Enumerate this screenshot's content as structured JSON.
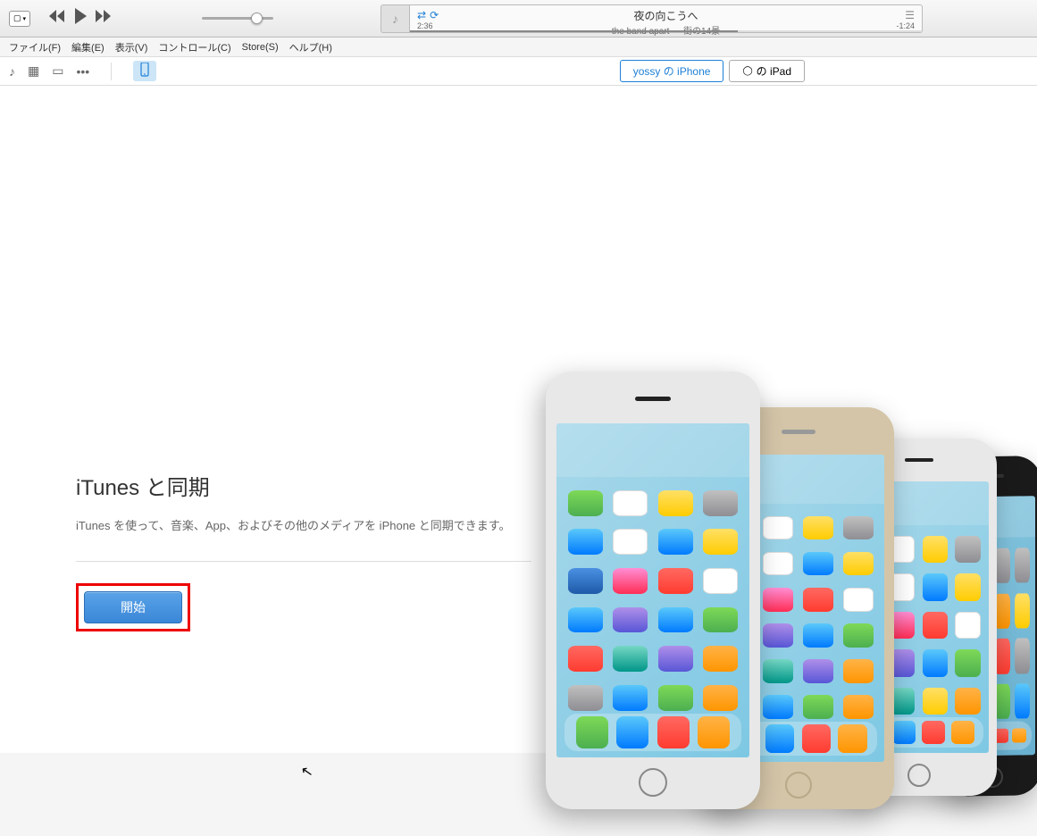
{
  "player": {
    "elapsed": "2:36",
    "remaining": "-1:24",
    "track_title": "夜の向こうへ",
    "track_artist": "the band apart — 街の14景"
  },
  "menu": {
    "file": "ファイル(F)",
    "edit": "編集(E)",
    "view": "表示(V)",
    "control": "コントロール(C)",
    "store": "Store(S)",
    "help": "ヘルプ(H)"
  },
  "devices": {
    "iphone_label": "yossy の iPhone",
    "ipad_label": "の iPad"
  },
  "sync": {
    "title": "iTunes と同期",
    "description": "iTunes を使って、音楽、App、およびその他のメディアを iPhone と同期できます。",
    "button": "開始"
  }
}
